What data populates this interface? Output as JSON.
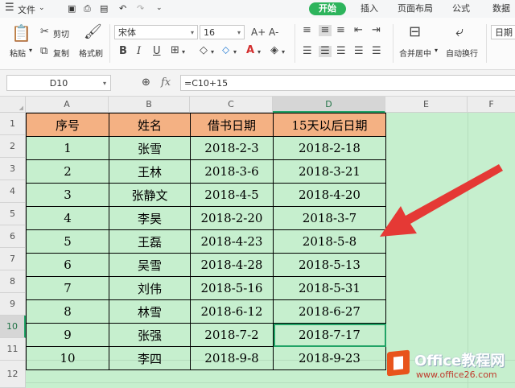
{
  "menubar": {
    "file_label": "文件",
    "tabs": [
      {
        "label": "开始",
        "active": true
      },
      {
        "label": "插入"
      },
      {
        "label": "页面布局"
      },
      {
        "label": "公式"
      },
      {
        "label": "数据"
      }
    ]
  },
  "toolbar": {
    "paste_label": "粘贴",
    "cut_label": "剪切",
    "copy_label": "复制",
    "format_painter_label": "格式刷",
    "font_name": "宋体",
    "font_size": "16",
    "merge_center_label": "合并居中",
    "wrap_text_label": "自动换行",
    "number_format": "日期",
    "bold_glyph": "B",
    "italic_glyph": "I",
    "underline_glyph": "U",
    "grow_font_glyph": "A+",
    "shrink_font_glyph": "A-"
  },
  "formula_bar": {
    "cell_ref": "D10",
    "fx_label": "fx",
    "formula": "=C10+15"
  },
  "sheet": {
    "columns": [
      "A",
      "B",
      "C",
      "D",
      "E",
      "F"
    ],
    "rows": [
      "1",
      "2",
      "3",
      "4",
      "5",
      "6",
      "7",
      "8",
      "9",
      "10",
      "11",
      "12"
    ],
    "selected_cell": "D10",
    "headers": [
      "序号",
      "姓名",
      "借书日期",
      "15天以后日期"
    ],
    "data": [
      [
        "1",
        "张雪",
        "2018-2-3",
        "2018-2-18"
      ],
      [
        "2",
        "王林",
        "2018-3-6",
        "2018-3-21"
      ],
      [
        "3",
        "张静文",
        "2018-4-5",
        "2018-4-20"
      ],
      [
        "4",
        "李昊",
        "2018-2-20",
        "2018-3-7"
      ],
      [
        "5",
        "王磊",
        "2018-4-23",
        "2018-5-8"
      ],
      [
        "6",
        "吴雪",
        "2018-4-28",
        "2018-5-13"
      ],
      [
        "7",
        "刘伟",
        "2018-5-16",
        "2018-5-31"
      ],
      [
        "8",
        "林雪",
        "2018-6-12",
        "2018-6-27"
      ],
      [
        "9",
        "张强",
        "2018-7-2",
        "2018-7-17"
      ],
      [
        "10",
        "李四",
        "2018-9-8",
        "2018-9-23"
      ]
    ]
  },
  "watermark": {
    "brand": "Office教程网",
    "url": "www.office26.com"
  },
  "colors": {
    "accent": "#2db45c",
    "header_fill": "#f4b183",
    "sheet_fill": "#c6efce",
    "arrow": "#e53935",
    "logo_orange": "#e8541c"
  }
}
